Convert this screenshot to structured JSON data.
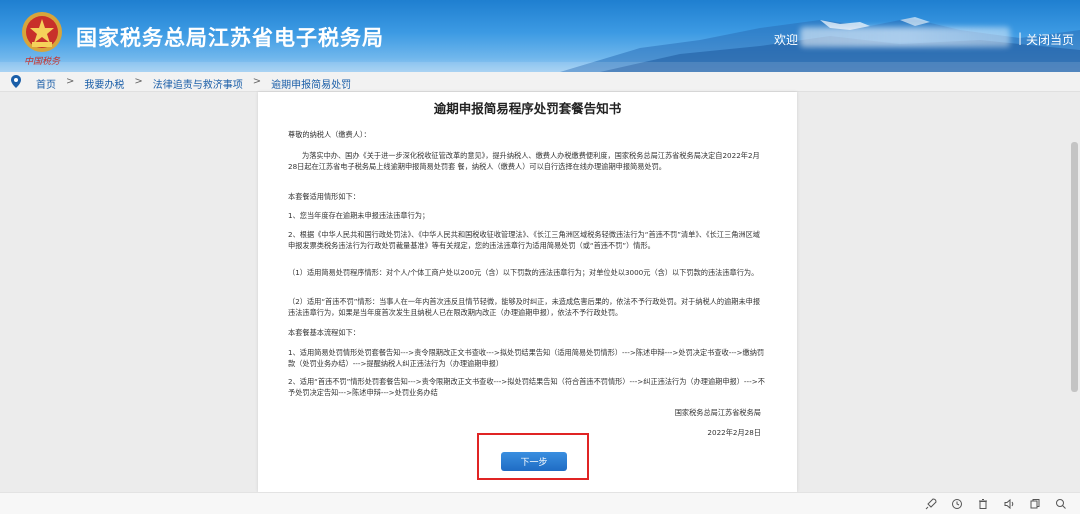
{
  "header": {
    "site_title": "国家税务总局江苏省电子税务局",
    "emblem_script": "中国税务",
    "welcome": "欢迎",
    "separator": "|",
    "close_label": "关闭当页"
  },
  "breadcrumb": {
    "items": [
      "首页",
      "我要办税",
      "法律追责与救济事项",
      "逾期申报简易处罚"
    ],
    "separator": ">"
  },
  "document": {
    "title": "逾期申报简易程序处罚套餐告知书",
    "greeting": "尊敬的纳税人（缴费人）：",
    "intro": "为落实中办、国办《关于进一步深化税收征管改革的意见》，提升纳税人、缴费人办税缴费便利度，国家税务总局江苏省税务局决定自2022年2月28日起在江苏省电子税务局上线逾期申报简易处罚套 餐，纳税人（缴费人）可以自行选择在线办理逾期申报简易处罚。",
    "scope_heading": "本套餐适用情形如下：",
    "scope_1": "1、您当年度存在逾期未申报违法违章行为；",
    "scope_2": "2、根据《中华人民共和国行政处罚法》、《中华人民共和国税收征收管理法》、《长江三角洲区域税务轻微违法行为“首违不罚”清单》、《长江三角洲区域申报发票类税务违法行为行政处罚裁量基准》等有关规定，您的违法违章行为适用简易处罚（或“首违不罚”）情形。",
    "scope_3": "（1）适用简易处罚程序情形：对个人/个体工商户处以200元（含）以下罚款的违法违章行为；对单位处以3000元（含）以下罚款的违法违章行为。",
    "scope_4": "（2）适用“首违不罚”情形：当事人在一年内首次违反且情节轻微，能够及时纠正，未造成危害后果的，依法不予行政处罚。对于纳税人的逾期未申报违法违章行为，如果是当年度首次发生且纳税人已在限改期内改正（办理逾期申报），依法不予行政处罚。",
    "process_heading": "本套餐基本流程如下：",
    "process_1": "1、适用简易处罚情形处罚套餐告知--->责令限期改正文书查收--->拟处罚结果告知（适用简易处罚情形）--->陈述申辩--->处罚决定书查收--->缴纳罚款（处罚业务办结）--->提醒纳税人纠正违法行为（办理逾期申报）",
    "process_2": "2、适用“首违不罚”情形处罚套餐告知--->责令限期改正文书查收--->拟处罚结果告知（符合首违不罚情形）--->纠正违法行为（办理逾期申报）--->不予处罚决定告知--->陈述申辩--->处罚业务办结",
    "signature": "国家税务总局江苏省税务局",
    "date": "2022年2月28日",
    "next_button": "下一步"
  },
  "icons": [
    "rocket-icon",
    "history-icon",
    "trash-icon",
    "speaker-icon",
    "copy-icon",
    "window-icon",
    "search-icon"
  ],
  "colors": {
    "header_blue": "#1f7fd0",
    "button_blue": "#1f6cc4",
    "highlight_red": "#e02424",
    "link_blue": "#1a5ea8"
  }
}
